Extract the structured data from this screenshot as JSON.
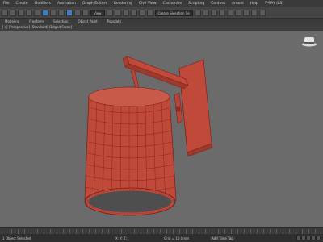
{
  "menu": [
    "File",
    "Create",
    "Modifiers",
    "Animation",
    "Graph Editors",
    "Rendering",
    "Civil View",
    "Customize",
    "Scripting",
    "Content",
    "Arnold",
    "Help",
    "V-RAY (LS)"
  ],
  "toolbar": {
    "selection_set": "Create Selection Se",
    "view_dropdown": "View"
  },
  "ribbon_tabs": [
    "Modeling",
    "Freeform",
    "Selection",
    "Object Paint",
    "Populate"
  ],
  "viewport": {
    "label": "[+] [Perspective] [Standard] [Edged Faces]"
  },
  "scene": {
    "object_color": "#c04a3a",
    "wire_color": "#7a1a14",
    "background": "#6b6b6b"
  },
  "status": {
    "selection": "1 Object Selected",
    "coords": "X:  Y:  Z:",
    "grid": "Grid = 10.0mm",
    "add_time_tag": "Add Time Tag"
  }
}
